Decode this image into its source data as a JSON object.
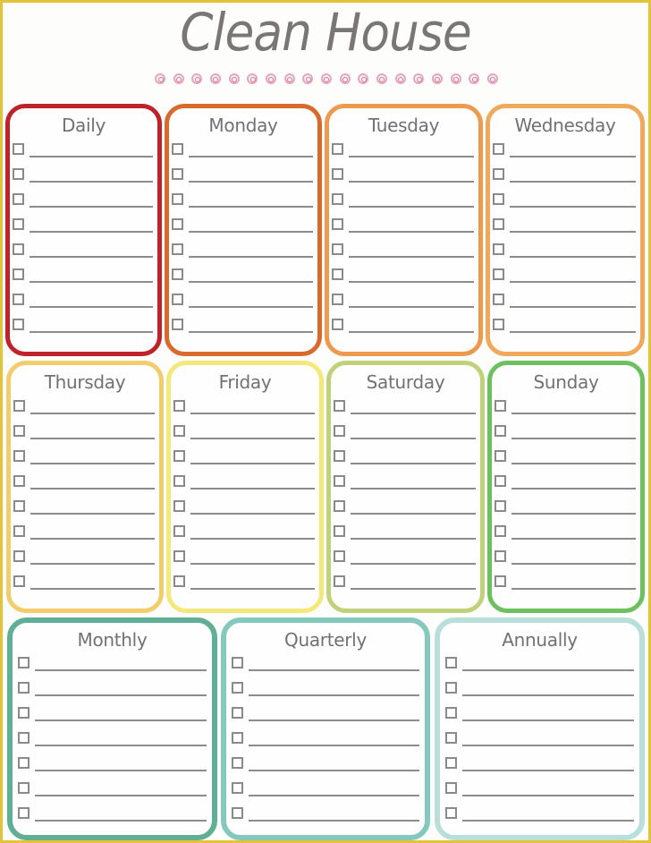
{
  "page": {
    "title": "Clean House",
    "frame_color": "#e3c33a",
    "divider": {
      "icon": "concentric-circle-icon",
      "count": 19,
      "color": "#e7a6bf"
    }
  },
  "cards": [
    {
      "id": "daily",
      "title": "Daily",
      "color": "#c0222a",
      "item_count": 8
    },
    {
      "id": "monday",
      "title": "Monday",
      "color": "#d96a2e",
      "item_count": 8
    },
    {
      "id": "tuesday",
      "title": "Tuesday",
      "color": "#ee9a4e",
      "item_count": 8
    },
    {
      "id": "wednesday",
      "title": "Wednesday",
      "color": "#f0a95a",
      "item_count": 8
    },
    {
      "id": "thursday",
      "title": "Thursday",
      "color": "#f3cc6b",
      "item_count": 8
    },
    {
      "id": "friday",
      "title": "Friday",
      "color": "#f4e87a",
      "item_count": 8
    },
    {
      "id": "saturday",
      "title": "Saturday",
      "color": "#bfd27a",
      "item_count": 8
    },
    {
      "id": "sunday",
      "title": "Sunday",
      "color": "#6cc05e",
      "item_count": 8
    },
    {
      "id": "monthly",
      "title": "Monthly",
      "color": "#5fae96",
      "item_count": 7
    },
    {
      "id": "quarterly",
      "title": "Quarterly",
      "color": "#85c9be",
      "item_count": 7
    },
    {
      "id": "annually",
      "title": "Annually",
      "color": "#b9dfdb",
      "item_count": 7
    }
  ]
}
